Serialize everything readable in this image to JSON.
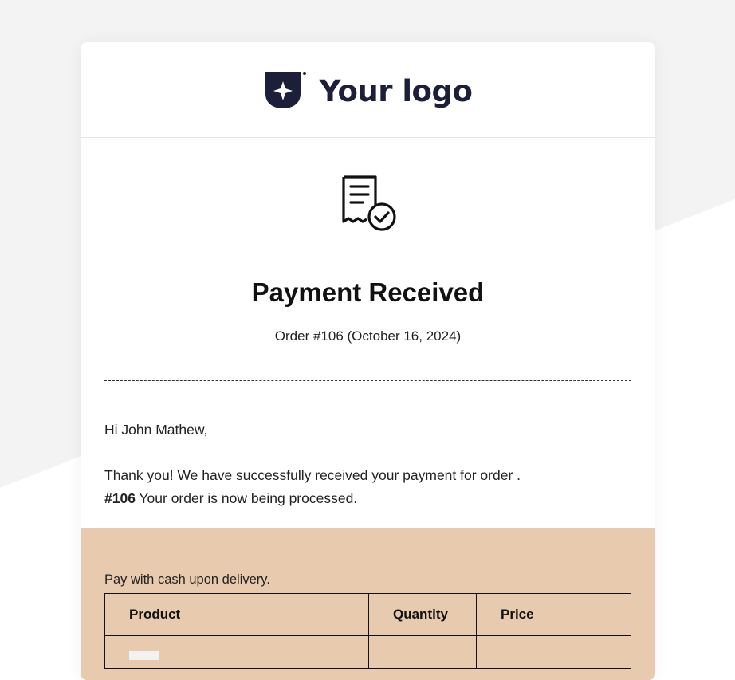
{
  "header": {
    "logo_text": "Your logo",
    "logo_icon": "shield-star-icon"
  },
  "hero": {
    "icon": "receipt-check-icon",
    "title": "Payment Received",
    "order_line": "Order #106 (October 16, 2024)"
  },
  "body": {
    "greeting": "Hi John Mathew,",
    "message_part1": "Thank you! We have successfully received your payment for order .",
    "order_number": "#106",
    "message_part2": " Your order is now being processed."
  },
  "payment": {
    "note": "Pay with cash upon delivery.",
    "table_headers": [
      "Product",
      "Quantity",
      "Price"
    ]
  },
  "colors": {
    "accent_band": "#e8cbae",
    "logo_color": "#1b1f3a"
  }
}
